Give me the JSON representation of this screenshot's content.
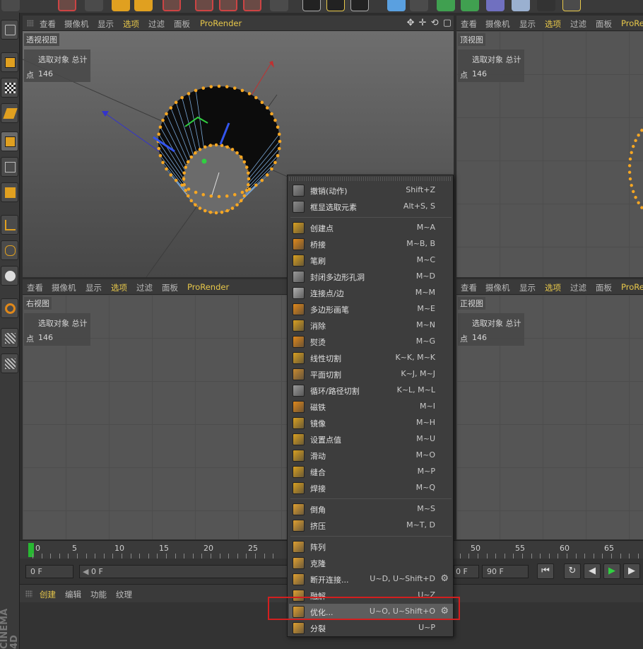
{
  "viewport_menu": [
    "查看",
    "摄像机",
    "显示",
    "选项",
    "过滤",
    "面板",
    "ProRender"
  ],
  "viewports": [
    {
      "name": "透视视图",
      "info_title": "选取对象 总计",
      "info_label": "点",
      "info_value": "146"
    },
    {
      "name": "顶视图",
      "info_title": "选取对象 总计",
      "info_label": "点",
      "info_value": "146"
    },
    {
      "name": "右视图",
      "info_title": "选取对象 总计",
      "info_label": "点",
      "info_value": "146"
    },
    {
      "name": "正视图",
      "info_title": "选取对象 总计",
      "info_label": "点",
      "info_value": "146"
    }
  ],
  "context_menu": {
    "items": [
      {
        "label": "撤销(动作)",
        "shortcut": "Shift+Z",
        "icon": "undo-icon",
        "color": "#8a8a8a"
      },
      {
        "label": "框显选取元素",
        "shortcut": "Alt+S, S",
        "icon": "frame-selection-icon",
        "color": "#8a8a8a"
      },
      {
        "label": "创建点",
        "shortcut": "M~A",
        "icon": "create-point-icon",
        "color": "#d9a020"
      },
      {
        "label": "桥接",
        "shortcut": "M~B, B",
        "icon": "bridge-icon",
        "color": "#e0881a"
      },
      {
        "label": "笔刷",
        "shortcut": "M~C",
        "icon": "brush-icon",
        "color": "#d9a020"
      },
      {
        "label": "封闭多边形孔洞",
        "shortcut": "M~D",
        "icon": "close-hole-icon",
        "color": "#9a9a9a"
      },
      {
        "label": "连接点/边",
        "shortcut": "M~M",
        "icon": "connect-icon",
        "color": "#b0b0b0"
      },
      {
        "label": "多边形画笔",
        "shortcut": "M~E",
        "icon": "polygon-pen-icon",
        "color": "#e0881a"
      },
      {
        "label": "消除",
        "shortcut": "M~N",
        "icon": "dissolve-icon",
        "color": "#d9a020"
      },
      {
        "label": "熨烫",
        "shortcut": "M~G",
        "icon": "iron-icon",
        "color": "#e0881a"
      },
      {
        "label": "线性切割",
        "shortcut": "K~K, M~K",
        "icon": "line-cut-icon",
        "color": "#d9a020"
      },
      {
        "label": "平面切割",
        "shortcut": "K~J, M~J",
        "icon": "plane-cut-icon",
        "color": "#c88a30"
      },
      {
        "label": "循环/路径切割",
        "shortcut": "K~L, M~L",
        "icon": "loop-cut-icon",
        "color": "#9a9a9a"
      },
      {
        "label": "磁铁",
        "shortcut": "M~I",
        "icon": "magnet-icon",
        "color": "#e0881a"
      },
      {
        "label": "镜像",
        "shortcut": "M~H",
        "icon": "mirror-icon",
        "color": "#d9a020"
      },
      {
        "label": "设置点值",
        "shortcut": "M~U",
        "icon": "set-point-value-icon",
        "color": "#d9a020"
      },
      {
        "label": "滑动",
        "shortcut": "M~O",
        "icon": "slide-icon",
        "color": "#d9a020"
      },
      {
        "label": "缝合",
        "shortcut": "M~P",
        "icon": "stitch-icon",
        "color": "#d9a020"
      },
      {
        "label": "焊接",
        "shortcut": "M~Q",
        "icon": "weld-icon",
        "color": "#d9a020"
      },
      {
        "label": "倒角",
        "shortcut": "M~S",
        "icon": "bevel-icon",
        "color": "#e0a030"
      },
      {
        "label": "挤压",
        "shortcut": "M~T, D",
        "icon": "extrude-icon",
        "color": "#e0a030"
      },
      {
        "label": "阵列",
        "shortcut": "",
        "icon": "array-icon",
        "color": "#e0a030"
      },
      {
        "label": "克隆",
        "shortcut": "",
        "icon": "clone-icon",
        "color": "#e0a030"
      },
      {
        "label": "断开连接...",
        "shortcut": "U~D, U~Shift+D",
        "icon": "disconnect-icon",
        "color": "#e0a030",
        "gear": true
      },
      {
        "label": "融解",
        "shortcut": "U~Z",
        "icon": "melt-icon",
        "color": "#e0a030"
      },
      {
        "label": "优化...",
        "shortcut": "U~O, U~Shift+O",
        "icon": "optimize-icon",
        "color": "#e0a030",
        "gear": true,
        "highlighted": true
      },
      {
        "label": "分裂",
        "shortcut": "U~P",
        "icon": "split-icon",
        "color": "#e0a030"
      }
    ]
  },
  "timeline": {
    "ticks": [
      "0",
      "5",
      "10",
      "15",
      "20",
      "25",
      "50",
      "55",
      "60",
      "65"
    ]
  },
  "playback": {
    "start_frame": "0 F",
    "current_frame": "0 F",
    "end_frame_a": "0 F",
    "end_frame_b": "90 F"
  },
  "material_manager": {
    "tabs": [
      "创建",
      "编辑",
      "功能",
      "纹理"
    ]
  },
  "brand": "CINEMA 4D",
  "colors": {
    "accent": "#e8c84a",
    "point": "#f5a623",
    "highlight_box": "#d31f1f",
    "playhead": "#28b832"
  }
}
